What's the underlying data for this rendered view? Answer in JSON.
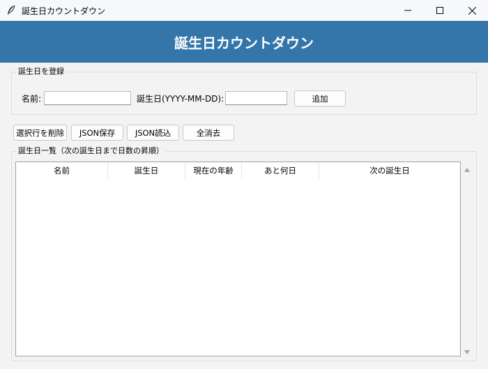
{
  "window": {
    "title": "誕生日カウントダウン",
    "controls": [
      "minimize-icon",
      "maximize-icon",
      "close-icon"
    ]
  },
  "header": {
    "title": "誕生日カウントダウン"
  },
  "register": {
    "group_title": "誕生日を登録",
    "name_label": "名前:",
    "name_value": "",
    "birthday_label": "誕生日(YYYY-MM-DD):",
    "birthday_value": "",
    "add_label": "追加"
  },
  "toolbar": {
    "delete_label": "選択行を削除",
    "json_save_label": "JSON保存",
    "json_load_label": "JSON読込",
    "clear_all_label": "全消去"
  },
  "list": {
    "group_title": "誕生日一覧（次の誕生日まで日数の昇順）",
    "columns": [
      "名前",
      "誕生日",
      "現在の年齢",
      "あと何日",
      "次の誕生日"
    ],
    "rows": []
  },
  "colors": {
    "header_bg": "#3475aa",
    "header_text": "#ffffff",
    "window_bg": "#f3f3f3"
  }
}
